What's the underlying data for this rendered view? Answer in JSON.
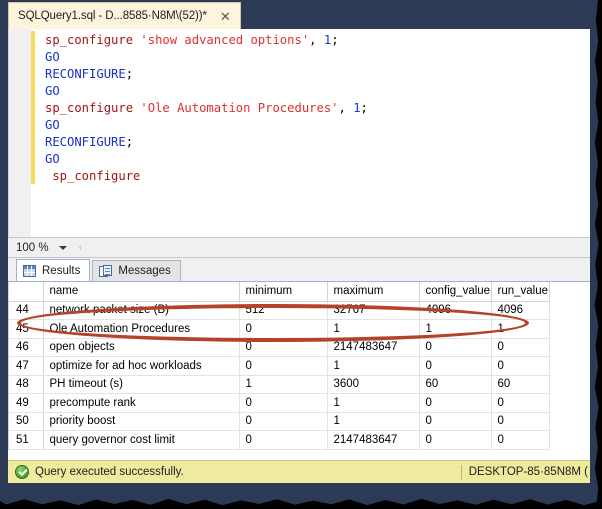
{
  "window": {
    "tab": {
      "title": "SQLQuery1.sql - D...8585·N8M\\(52))*",
      "close_label": "✕"
    }
  },
  "editor": {
    "lines": [
      {
        "parts": [
          {
            "t": "sp_configure ",
            "c": "proc"
          },
          {
            "t": "'show advanced options'",
            "c": "str"
          },
          {
            "t": ", ",
            "c": "pun"
          },
          {
            "t": "1",
            "c": "num"
          },
          {
            "t": ";",
            "c": "pun"
          }
        ]
      },
      {
        "parts": [
          {
            "t": "GO",
            "c": "kw"
          }
        ]
      },
      {
        "parts": [
          {
            "t": "RECONFIGURE",
            "c": "kw"
          },
          {
            "t": ";",
            "c": "pun"
          }
        ]
      },
      {
        "parts": [
          {
            "t": "GO",
            "c": "kw"
          }
        ]
      },
      {
        "parts": [
          {
            "t": "sp_configure ",
            "c": "proc"
          },
          {
            "t": "'Ole Automation Procedures'",
            "c": "str"
          },
          {
            "t": ", ",
            "c": "pun"
          },
          {
            "t": "1",
            "c": "num"
          },
          {
            "t": ";",
            "c": "pun"
          }
        ]
      },
      {
        "parts": [
          {
            "t": "GO",
            "c": "kw"
          }
        ]
      },
      {
        "parts": [
          {
            "t": "RECONFIGURE",
            "c": "kw"
          },
          {
            "t": ";",
            "c": "pun"
          }
        ]
      },
      {
        "parts": [
          {
            "t": "GO",
            "c": "kw"
          }
        ]
      },
      {
        "parts": [
          {
            "t": " sp_configure",
            "c": "proc"
          }
        ]
      }
    ]
  },
  "zoombar": {
    "zoom_level": "100 %",
    "separator": "‹"
  },
  "results_pane": {
    "tabs": [
      {
        "label": "Results",
        "icon": "grid-icon",
        "active": true
      },
      {
        "label": "Messages",
        "icon": "message-icon",
        "active": false
      }
    ],
    "grid": {
      "columns": [
        "",
        "name",
        "minimum",
        "maximum",
        "config_value",
        "run_value"
      ],
      "rows": [
        {
          "num": "44",
          "name": "network packet size (B)",
          "minimum": "512",
          "maximum": "32767",
          "config_value": "4096",
          "run_value": "4096"
        },
        {
          "num": "45",
          "name": "Ole Automation Procedures",
          "minimum": "0",
          "maximum": "1",
          "config_value": "1",
          "run_value": "1",
          "highlighted": true
        },
        {
          "num": "46",
          "name": "open objects",
          "minimum": "0",
          "maximum": "2147483647",
          "config_value": "0",
          "run_value": "0"
        },
        {
          "num": "47",
          "name": "optimize for ad hoc workloads",
          "minimum": "0",
          "maximum": "1",
          "config_value": "0",
          "run_value": "0"
        },
        {
          "num": "48",
          "name": "PH timeout (s)",
          "minimum": "1",
          "maximum": "3600",
          "config_value": "60",
          "run_value": "60"
        },
        {
          "num": "49",
          "name": "precompute rank",
          "minimum": "0",
          "maximum": "1",
          "config_value": "0",
          "run_value": "0"
        },
        {
          "num": "50",
          "name": "priority boost",
          "minimum": "0",
          "maximum": "1",
          "config_value": "0",
          "run_value": "0"
        },
        {
          "num": "51",
          "name": "query governor cost limit",
          "minimum": "0",
          "maximum": "2147483647",
          "config_value": "0",
          "run_value": "0"
        }
      ]
    }
  },
  "statusbar": {
    "icon": "success-check-icon",
    "message": "Query executed successfully.",
    "server": "DESKTOP-85·85N8M ("
  },
  "colors": {
    "annotation_red": "#b5432a",
    "tab_cream": "#fdf4dd",
    "chrome_navy": "#2d3a56",
    "status_yellow": "#eeea9e",
    "change_bar_yellow": "#f5dd5c"
  }
}
